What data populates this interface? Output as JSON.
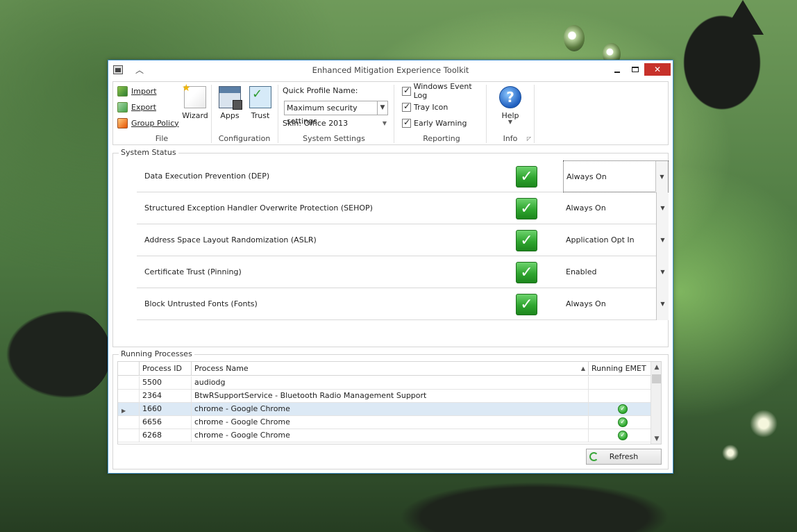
{
  "window": {
    "title": "Enhanced Mitigation Experience Toolkit"
  },
  "ribbon": {
    "file": {
      "label": "File",
      "import": "Import",
      "export": "Export",
      "group_policy": "Group Policy",
      "wizard": "Wizard"
    },
    "configuration": {
      "label": "Configuration",
      "apps": "Apps",
      "trust": "Trust"
    },
    "system_settings": {
      "label": "System Settings",
      "quick_profile_label": "Quick Profile Name:",
      "quick_profile_value": "Maximum security settings",
      "skin": "Skin: Office 2013"
    },
    "reporting": {
      "label": "Reporting",
      "windows_event_log": "Windows Event Log",
      "tray_icon": "Tray Icon",
      "early_warning": "Early Warning"
    },
    "info": {
      "label": "Info",
      "help": "Help"
    }
  },
  "system_status": {
    "legend": "System Status",
    "rows": [
      {
        "name": "Data Execution Prevention (DEP)",
        "value": "Always On"
      },
      {
        "name": "Structured Exception Handler Overwrite Protection (SEHOP)",
        "value": "Always On"
      },
      {
        "name": "Address Space Layout Randomization (ASLR)",
        "value": "Application Opt In"
      },
      {
        "name": "Certificate Trust (Pinning)",
        "value": "Enabled"
      },
      {
        "name": "Block Untrusted Fonts (Fonts)",
        "value": "Always On"
      }
    ]
  },
  "running_processes": {
    "legend": "Running Processes",
    "columns": {
      "pid": "Process ID",
      "name": "Process Name",
      "emet": "Running EMET"
    },
    "rows": [
      {
        "pid": "5500",
        "name": "audiodg",
        "emet": false
      },
      {
        "pid": "2364",
        "name": "BtwRSupportService - Bluetooth Radio Management Support",
        "emet": false
      },
      {
        "pid": "1660",
        "name": "chrome - Google Chrome",
        "emet": true
      },
      {
        "pid": "6656",
        "name": "chrome - Google Chrome",
        "emet": true
      },
      {
        "pid": "6268",
        "name": "chrome - Google Chrome",
        "emet": true
      }
    ],
    "refresh": "Refresh"
  },
  "colors": {
    "accent": "#3f8ec9",
    "close": "#c7312a",
    "ok_green": "#2fa52f",
    "selected_row": "#dce9f5"
  }
}
